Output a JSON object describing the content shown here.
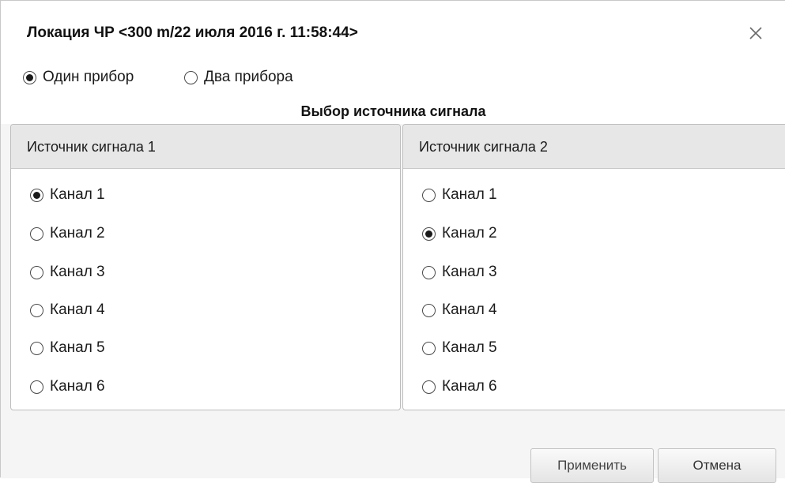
{
  "dialog": {
    "title": "Локация ЧР <300 m/22 июля 2016 г. 11:58:44>",
    "close_icon": "close-icon"
  },
  "mode": {
    "options": [
      {
        "label": "Один прибор",
        "checked": true
      },
      {
        "label": "Два прибора",
        "checked": false
      }
    ]
  },
  "section_title": "Выбор источника сигнала",
  "sources": [
    {
      "header": "Источник сигнала 1",
      "channels": [
        {
          "label": "Канал 1",
          "checked": true
        },
        {
          "label": "Канал 2",
          "checked": false
        },
        {
          "label": "Канал 3",
          "checked": false
        },
        {
          "label": "Канал 4",
          "checked": false
        },
        {
          "label": "Канал 5",
          "checked": false
        },
        {
          "label": "Канал 6",
          "checked": false
        }
      ]
    },
    {
      "header": "Источник сигнала 2",
      "channels": [
        {
          "label": "Канал 1",
          "checked": false
        },
        {
          "label": "Канал 2",
          "checked": true
        },
        {
          "label": "Канал 3",
          "checked": false
        },
        {
          "label": "Канал 4",
          "checked": false
        },
        {
          "label": "Канал 5",
          "checked": false
        },
        {
          "label": "Канал 6",
          "checked": false
        }
      ]
    }
  ],
  "buttons": {
    "apply_label": "Применить",
    "cancel_label": "Отмена"
  }
}
